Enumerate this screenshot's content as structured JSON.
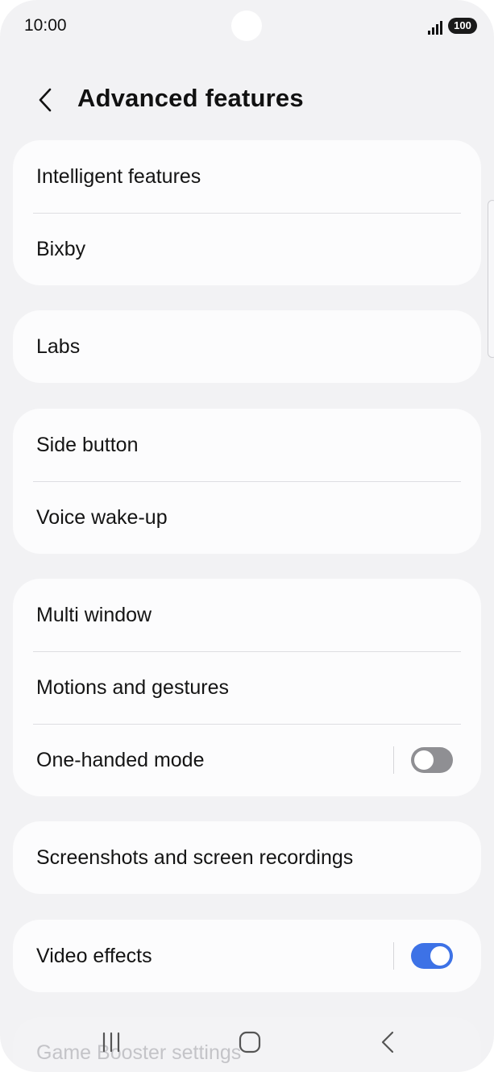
{
  "status_bar": {
    "time": "10:00",
    "battery": "100",
    "icons": [
      "signal-icon",
      "battery-icon"
    ]
  },
  "header": {
    "title": "Advanced features",
    "back_icon": "chevron-left-icon"
  },
  "groups": [
    {
      "items": [
        {
          "label": "Intelligent features"
        },
        {
          "label": "Bixby"
        }
      ]
    },
    {
      "items": [
        {
          "label": "Labs"
        }
      ]
    },
    {
      "items": [
        {
          "label": "Side button"
        },
        {
          "label": "Voice wake-up"
        }
      ]
    },
    {
      "items": [
        {
          "label": "Multi window"
        },
        {
          "label": "Motions and gestures"
        },
        {
          "label": "One-handed mode",
          "toggle": false
        }
      ]
    },
    {
      "items": [
        {
          "label": "Screenshots and screen recordings"
        }
      ]
    },
    {
      "items": [
        {
          "label": "Video effects",
          "toggle": true
        }
      ]
    },
    {
      "items": [
        {
          "label": "Game Booster settings"
        }
      ]
    }
  ],
  "nav_bar": {
    "icons": [
      "recents-icon",
      "home-icon",
      "back-icon"
    ]
  },
  "colors": {
    "background": "#f2f2f4",
    "card": "#fcfcfd",
    "toggle_on": "#3d72e6",
    "toggle_off": "#8f8f93"
  }
}
